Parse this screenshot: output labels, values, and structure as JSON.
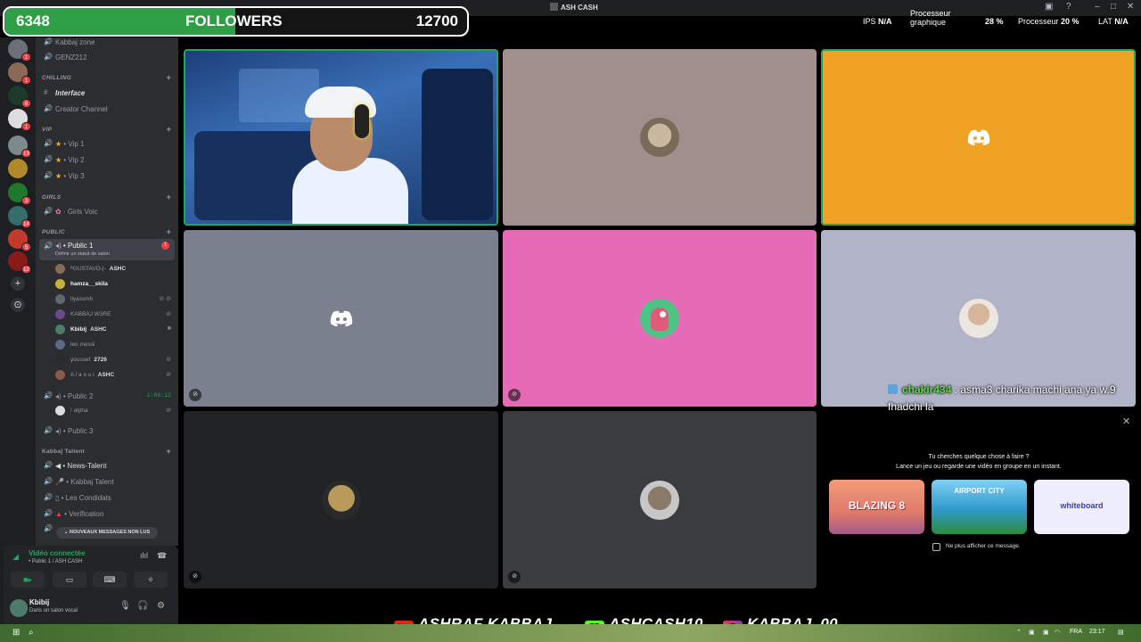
{
  "window": {
    "title": "ASH CASH"
  },
  "followers": {
    "current": "6348",
    "label": "FOLLOWERS",
    "goal": "12700",
    "progress": 0.4998
  },
  "perf": {
    "ips_label": "IPS",
    "ips_value": "N/A",
    "gpu_label_1": "Processeur",
    "gpu_label_2": "graphique",
    "gpu_value": "28 %",
    "cpu_label": "Processeur",
    "cpu_value": "20 %",
    "lat_label": "LAT",
    "lat_value": "N/A"
  },
  "servers": [
    {
      "color": "#6d6f78",
      "badge": "1"
    },
    {
      "color": "#8a6a55",
      "badge": "1"
    },
    {
      "color": "#1b3b2a",
      "badge": "6"
    },
    {
      "color": "#dddddd",
      "badge": "1"
    },
    {
      "color": "#7d8a8c",
      "badge": "13"
    },
    {
      "color": "#b08a2a",
      "badge": ""
    },
    {
      "color": "#1d7a2a",
      "badge": "3"
    },
    {
      "color": "#356d6a",
      "badge": "14"
    },
    {
      "color": "#c23a2a",
      "badge": "5"
    },
    {
      "color": "#8a1a1a",
      "badge": "12"
    }
  ],
  "channels": {
    "top_partial": "Kabbaj zone",
    "genz": "GENZ212",
    "cat_chilling": "CHILLING",
    "interface": "Interface",
    "creator": "Creator Channel",
    "cat_vip": "VIP",
    "vip1": "• Vip 1",
    "vip2": "• Vip 2",
    "vip3": "• Vip 3",
    "cat_girls": "GIRLS",
    "girls": "· Girls Voic",
    "cat_public": "PUBLIC",
    "public1": "• Public 1",
    "public1_badge": "1",
    "public1_status": "Définir un statut de salon",
    "public2": "• Public 2",
    "public2_timer": "1:06:12",
    "alpha": "! alpha",
    "public3": "• Public 3",
    "cat_talent": "Kabbaj Tallent",
    "news": "• News-Talent",
    "kabbaj_talent": "• Kabbaj Talent",
    "condidats": "• Les Condidats",
    "verification": "• Verification",
    "new_messages": "NOUVEAUX MESSAGES NON LUS"
  },
  "voice_users": [
    {
      "name": "ᴿGUSTAVO-|-",
      "tag": "ASHC",
      "color": "#8a6a55",
      "bold": false
    },
    {
      "name": "hamza__skila",
      "tag": "",
      "color": "#c7b23a",
      "bold": true
    },
    {
      "name": "llyassmh",
      "tag": "",
      "color": "#5e6a6a",
      "bold": false
    },
    {
      "name": "KABBAJ W3RE",
      "tag": "",
      "color": "#6a4a8a",
      "bold": false
    },
    {
      "name": "Kbibij",
      "tag": "ASHC",
      "color": "#4e7b6a",
      "bold": true
    },
    {
      "name": "leo messi",
      "tag": "",
      "color": "#5a6a8a",
      "bold": false
    },
    {
      "name": "youssef",
      "tag": "2726",
      "color": "#2a2a2a",
      "bold": false
    },
    {
      "name": "A l a o u i",
      "tag": "ASHC",
      "color": "#8a5a4a",
      "bold": false
    }
  ],
  "voice_panel": {
    "status": "Vidéo connectée",
    "channel": "• Public 1 / ASH CASH"
  },
  "user_panel": {
    "name": "Kbibij",
    "status": "Dans un salon vocal"
  },
  "chat": {
    "user": "chakir434",
    "message": ": asma3 charika machi ana ya w.9 fhadchi la"
  },
  "activity": {
    "question": "Tu cherches quelque chose à faire ?",
    "sub": "Lance un jeu ou regarde une vidéo en groupe en un instant.",
    "cards": [
      {
        "label": "BLAZING 8",
        "bg": "#e07a6a"
      },
      {
        "label": "AIRPORT CITY",
        "bg": "#2f9acb"
      },
      {
        "label": "whiteboard",
        "bg": "#eeeeff"
      }
    ],
    "checkbox_label": "Ne plus afficher ce message."
  },
  "social": {
    "youtube": "ASHRAF KABBAJ",
    "kick": "ASHCASH10",
    "instagram": "KABBAJ_00"
  },
  "taskbar": {
    "lang": "FRA",
    "time": "23:17"
  },
  "colors": {
    "tile_orange": "#f0a224",
    "tile_pink": "#e66bb7",
    "tile_lavender": "#b1b3c8",
    "tile_grey": "#7a808d",
    "tile_taupe": "#a08f8c",
    "tile_dark": "#202225",
    "tile_mid": "#3a3c40"
  }
}
